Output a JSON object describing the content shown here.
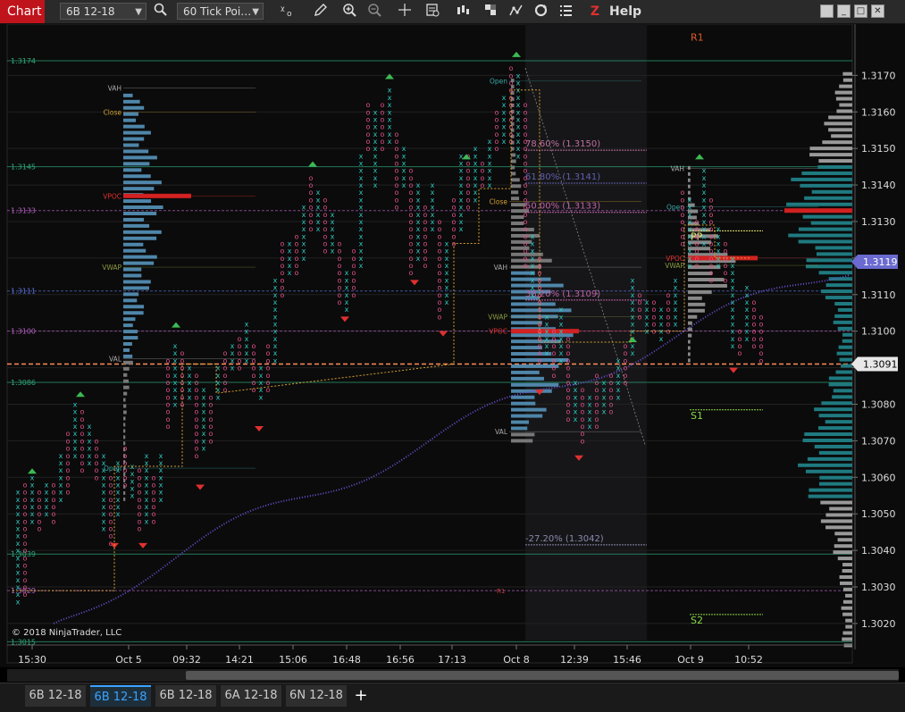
{
  "toolbar": {
    "app_title": "Chart",
    "instrument": "6B 12-18",
    "bar_type": "60 Tick Poi…",
    "help": "Help",
    "icons": [
      "magnifier-icon",
      "bars-x-icon",
      "pencil-icon",
      "zoom-in-icon",
      "zoom-out-icon",
      "crosshair-icon",
      "data-box-icon",
      "chart-style-icon",
      "strategy-icon",
      "indicator-icon",
      "refresh-icon",
      "list-icon",
      "z-order-icon"
    ]
  },
  "chart_data": {
    "type": "point-and-figure",
    "instrument": "6B 12-18",
    "copyright": "© 2018 NinjaTrader, LLC",
    "last_price_label": "1.3119",
    "crosshair_price_label": "1.3091",
    "price_ticks": [
      "1.3170",
      "1.3160",
      "1.3150",
      "1.3140",
      "1.3130",
      "1.3120",
      "1.3110",
      "1.3100",
      "1.3090",
      "1.3080",
      "1.3070",
      "1.3060",
      "1.3050",
      "1.3040",
      "1.3030",
      "1.3020"
    ],
    "price_tick_values": [
      1.317,
      1.316,
      1.315,
      1.314,
      1.313,
      1.312,
      1.311,
      1.31,
      1.309,
      1.308,
      1.307,
      1.306,
      1.305,
      1.304,
      1.303,
      1.302
    ],
    "ylim": [
      1.30146,
      1.31828
    ],
    "time_ticks": [
      "15:30",
      "Oct 5",
      "09:32",
      "14:21",
      "15:06",
      "16:48",
      "16:56",
      "17:13",
      "Oct 8",
      "12:39",
      "15:46",
      "Oct 9",
      "10:52"
    ],
    "left_levels": [
      {
        "label": "1.3174",
        "value": 1.3174,
        "color": "#2ea87a"
      },
      {
        "label": "1.3145",
        "value": 1.3145,
        "color": "#2ea87a"
      },
      {
        "label": "1.3133",
        "value": 1.3133,
        "color": "#b05fc0"
      },
      {
        "label": "1.3111",
        "value": 1.3111,
        "color": "#5a6fd8"
      },
      {
        "label": "1.3100",
        "value": 1.31,
        "color": "#b05fc0"
      },
      {
        "label": "1.3086",
        "value": 1.3086,
        "color": "#2ea87a"
      },
      {
        "label": "1.3039",
        "value": 1.3039,
        "color": "#2ea87a"
      },
      {
        "label": "1.3029",
        "value": 1.3029,
        "color": "#b05fc0"
      },
      {
        "label": "1.3015",
        "value": 1.3015,
        "color": "#2ea87a"
      }
    ],
    "profile_labels_1": [
      {
        "label": "VAH",
        "value": 1.31665,
        "color": "#aaaaaa"
      },
      {
        "label": "Close",
        "value": 1.316,
        "color": "#d4a030"
      },
      {
        "label": "VPOC",
        "value": 1.3137,
        "color": "#e03030"
      },
      {
        "label": "VWAP",
        "value": 1.31175,
        "color": "#8a9a40"
      },
      {
        "label": "VAL",
        "value": 1.30925,
        "color": "#aaaaaa"
      },
      {
        "label": "Open",
        "value": 1.30625,
        "color": "#3aa8a8"
      }
    ],
    "profile_labels_2": [
      {
        "label": "Open",
        "value": 1.31685,
        "color": "#3aa8a8"
      },
      {
        "label": "Close",
        "value": 1.31355,
        "color": "#d4a030"
      },
      {
        "label": "VAH",
        "value": 1.31175,
        "color": "#aaaaaa"
      },
      {
        "label": "VWAP",
        "value": 1.3104,
        "color": "#8a9a40"
      },
      {
        "label": "VPOC",
        "value": 1.31,
        "color": "#e03030"
      },
      {
        "label": "VAL",
        "value": 1.30725,
        "color": "#aaaaaa"
      }
    ],
    "profile_labels_3": [
      {
        "label": "VAH",
        "value": 1.31445,
        "color": "#aaaaaa"
      },
      {
        "label": "Open",
        "value": 1.3134,
        "color": "#3aa8a8"
      },
      {
        "label": "VPOC",
        "value": 1.312,
        "color": "#e03030"
      },
      {
        "label": "VWAP",
        "value": 1.3118,
        "color": "#8a9a40"
      }
    ],
    "pivots": [
      {
        "label": "R1",
        "value": 1.31805,
        "color": "#e05a2a"
      },
      {
        "label": "PP",
        "value": 1.3126,
        "color": "#e8e870"
      },
      {
        "label": "S1",
        "value": 1.3077,
        "color": "#8bd84a"
      },
      {
        "label": "S2",
        "value": 1.3021,
        "color": "#8bd84a"
      }
    ],
    "fib_labels": [
      {
        "label": "78.60% (1.3150)",
        "value": 1.315,
        "color": "#c070a0"
      },
      {
        "label": "61.80% (1.3141)",
        "value": 1.3141,
        "color": "#6060b0"
      },
      {
        "label": "50.00% (1.3133)",
        "value": 1.3133,
        "color": "#c060a8"
      },
      {
        "label": "38.20% (1.3109)",
        "value": 1.3109,
        "color": "#c060a8"
      },
      {
        "label": "-27.20% (1.3042)",
        "value": 1.3042,
        "color": "#8a8ab0"
      }
    ],
    "r1_small": "R1",
    "colors": {
      "x_col": "#2ec8c0",
      "o_col": "#e0508a",
      "bg": "#0b0b0b",
      "grid": "#222222",
      "down_arrow": "#e03030",
      "up_arrow": "#3cba54",
      "vwap_line": "#6a4fd0",
      "close_line": "#d4a030"
    }
  },
  "tabs": [
    {
      "label": "6B 12-18",
      "active": false
    },
    {
      "label": "6B 12-18",
      "active": true
    },
    {
      "label": "6B 12-18",
      "active": false
    },
    {
      "label": "6A 12-18",
      "active": false
    },
    {
      "label": "6N 12-18",
      "active": false
    }
  ],
  "tab_add": "+"
}
